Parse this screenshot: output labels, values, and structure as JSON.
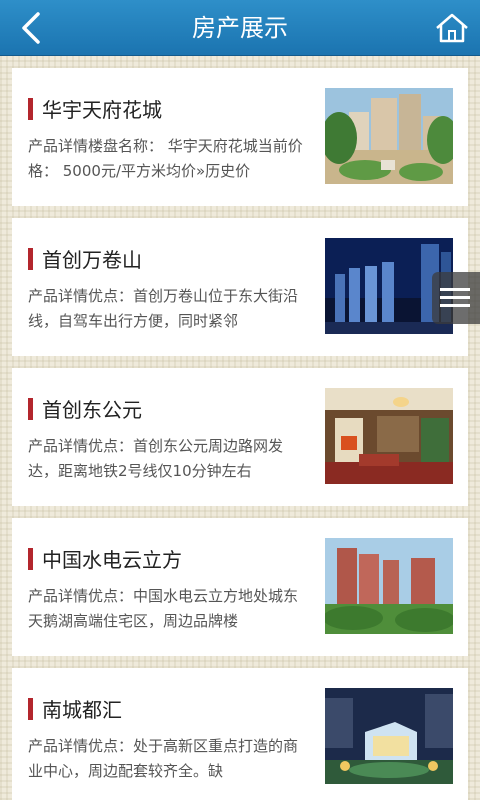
{
  "header": {
    "title": "房产展示",
    "back_icon": "back-arrow-icon",
    "home_icon": "home-icon",
    "color": "#1f7cbb"
  },
  "accent_color": "#b3262d",
  "floating_menu_icon": "hamburger-menu-icon",
  "listings": [
    {
      "name": "华宇天府花城",
      "desc": "产品详情楼盘名称： 华宇天府花城当前价格： 5000元/平方米均价»历史价"
    },
    {
      "name": "首创万卷山",
      "desc": "产品详情优点：首创万卷山位于东大街沿线，自驾车出行方便，同时紧邻"
    },
    {
      "name": "首创东公元",
      "desc": "产品详情优点：首创东公元周边路网发达，距离地铁2号线仅10分钟左右"
    },
    {
      "name": "中国水电云立方",
      "desc": "产品详情优点：中国水电云立方地处城东天鹅湖高端住宅区，周边品牌楼"
    },
    {
      "name": "南城都汇",
      "desc": "产品详情优点：处于高新区重点打造的商业中心，周边配套较齐全。缺"
    }
  ]
}
